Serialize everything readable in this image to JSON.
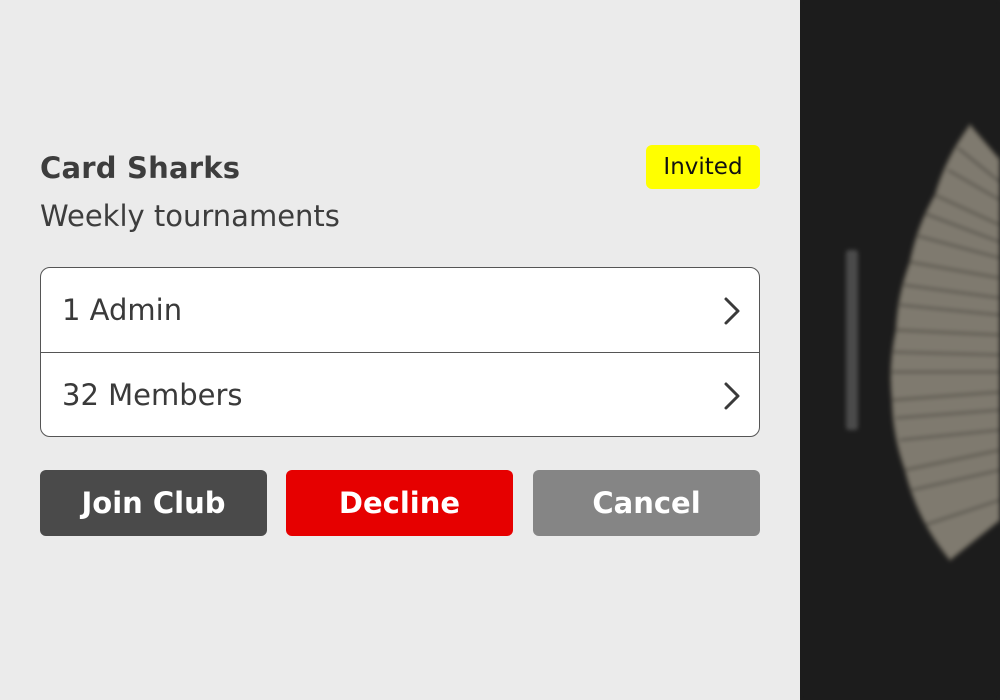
{
  "club": {
    "name": "Card Sharks",
    "description": "Weekly tournaments",
    "status_badge": "Invited"
  },
  "membership": {
    "rows": [
      {
        "label": "1 Admin"
      },
      {
        "label": "32 Members"
      }
    ]
  },
  "actions": {
    "join_label": "Join Club",
    "decline_label": "Decline",
    "cancel_label": "Cancel"
  },
  "colors": {
    "panel_background": "#ebebeb",
    "badge_background": "#ffff00",
    "join_button": "#4a4a4a",
    "decline_button": "#e60000",
    "cancel_button": "#858585",
    "preview_background": "#1e1e1e"
  },
  "preview": {
    "image": "blurred-card-fan-image"
  }
}
